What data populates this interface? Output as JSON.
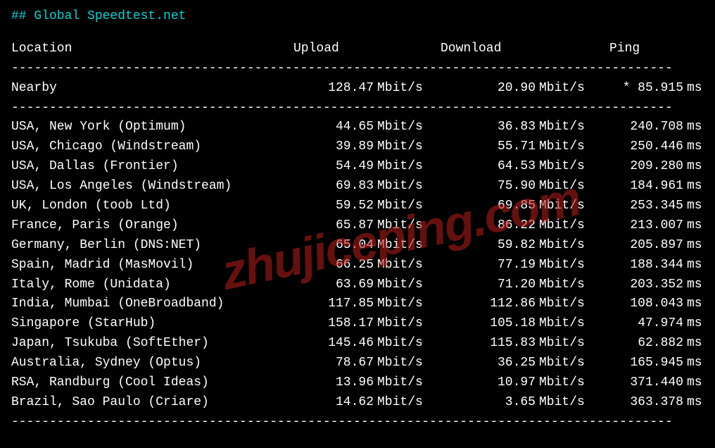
{
  "title": "## Global Speedtest.net",
  "headers": {
    "location": "Location",
    "upload": "Upload",
    "download": "Download",
    "ping": "Ping"
  },
  "divider": "---------------------------------------------------------------------------------------",
  "nearby": {
    "location": "Nearby",
    "upload": "128.47",
    "download": "20.90",
    "ping": "* 85.915",
    "speed_unit": "Mbit/s",
    "ping_unit": "ms"
  },
  "rows": [
    {
      "location": "USA, New York (Optimum)",
      "upload": "44.65",
      "download": "36.83",
      "ping": "240.708"
    },
    {
      "location": "USA, Chicago (Windstream)",
      "upload": "39.89",
      "download": "55.71",
      "ping": "250.446"
    },
    {
      "location": "USA, Dallas (Frontier)",
      "upload": "54.49",
      "download": "64.53",
      "ping": "209.280"
    },
    {
      "location": "USA, Los Angeles (Windstream)",
      "upload": "69.83",
      "download": "75.90",
      "ping": "184.961"
    },
    {
      "location": "UK, London (toob Ltd)",
      "upload": "59.52",
      "download": "69.85",
      "ping": "253.345"
    },
    {
      "location": "France, Paris (Orange)",
      "upload": "65.87",
      "download": "86.22",
      "ping": "213.007"
    },
    {
      "location": "Germany, Berlin (DNS:NET)",
      "upload": "65.04",
      "download": "59.82",
      "ping": "205.897"
    },
    {
      "location": "Spain, Madrid (MasMovil)",
      "upload": "66.25",
      "download": "77.19",
      "ping": "188.344"
    },
    {
      "location": "Italy, Rome (Unidata)",
      "upload": "63.69",
      "download": "71.20",
      "ping": "203.352"
    },
    {
      "location": "India, Mumbai (OneBroadband)",
      "upload": "117.85",
      "download": "112.86",
      "ping": "108.043"
    },
    {
      "location": "Singapore (StarHub)",
      "upload": "158.17",
      "download": "105.18",
      "ping": "47.974"
    },
    {
      "location": "Japan, Tsukuba (SoftEther)",
      "upload": "145.46",
      "download": "115.83",
      "ping": "62.882"
    },
    {
      "location": "Australia, Sydney (Optus)",
      "upload": "78.67",
      "download": "36.25",
      "ping": "165.945"
    },
    {
      "location": "RSA, Randburg (Cool Ideas)",
      "upload": "13.96",
      "download": "10.97",
      "ping": "371.440"
    },
    {
      "location": "Brazil, Sao Paulo (Criare)",
      "upload": "14.62",
      "download": "3.65",
      "ping": "363.378"
    }
  ],
  "units": {
    "speed": "Mbit/s",
    "ping": "ms"
  },
  "watermark": "zhujiceping.com"
}
